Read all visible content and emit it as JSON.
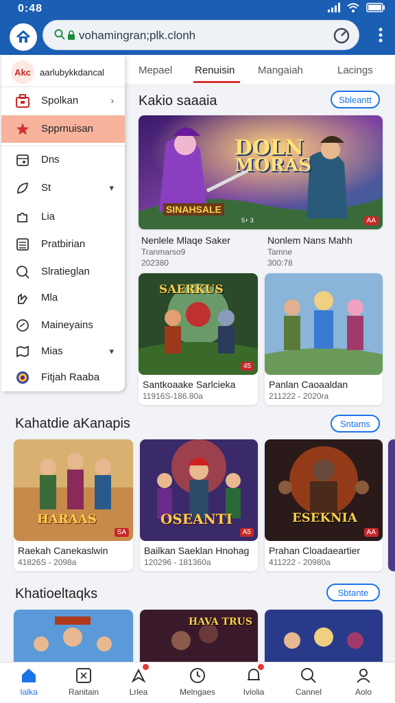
{
  "status": {
    "time": "0:48"
  },
  "browser": {
    "url": "vohamingran;plk.clonh"
  },
  "tabs": [
    {
      "label": "Mepael"
    },
    {
      "label": "Renuisin"
    },
    {
      "label": "Mangaiah"
    },
    {
      "label": "Lacings"
    }
  ],
  "drawer": {
    "logo": "Akc",
    "title": "aarlubykkdancal",
    "items": [
      {
        "label": "Spolkan",
        "chevron": "›"
      },
      {
        "label": "Spprnuisan",
        "chevron": ""
      },
      {
        "label": "Dns",
        "chevron": ""
      },
      {
        "label": "St",
        "chevron": "▾"
      },
      {
        "label": "Lia",
        "chevron": ""
      },
      {
        "label": "Pratbirian",
        "chevron": ""
      },
      {
        "label": "Slratieglan",
        "chevron": ""
      },
      {
        "label": "Mla",
        "chevron": ""
      },
      {
        "label": "Maineyains",
        "chevron": ""
      },
      {
        "label": "Mias",
        "chevron": "▾"
      },
      {
        "label": "Fitjah Raaba",
        "chevron": ""
      }
    ]
  },
  "section1": {
    "title": "Kakio saaaia",
    "pill": "Sbleantt",
    "hero": {
      "logo1": "DOLN",
      "logo2": "MORAS",
      "banner": "SINAHSALE",
      "badge": "AA",
      "badge2": "5+ 3"
    },
    "hero_left": {
      "name": "Nenlele Mlaqe Saker",
      "sub1": "Tranmarso9",
      "sub2": "202380"
    },
    "hero_right": {
      "name": "Nonlem Nans Mahh",
      "sub1": "Tamne",
      "sub2": "300:78"
    },
    "cards": [
      {
        "name": "Santkoaake Sarlcieka",
        "sub": "11916S-186.80a",
        "logo": "SAERKUS",
        "badge": "45"
      },
      {
        "name": "Panlan Caoaaldan",
        "sub": "211222 - 2020ra",
        "logo": "",
        "badge": ""
      }
    ]
  },
  "section2": {
    "title": "Kahatdie aKanapis",
    "pill": "Sntams",
    "cards": [
      {
        "name": "Raekah Canekaslwin",
        "sub": "41826S - 2098a",
        "logo": "HARAAS",
        "badge": "SA"
      },
      {
        "name": "Bailkan Saeklan Hnohag",
        "sub": "120296 - 181360a",
        "logo": "OSEANTI",
        "badge": "A5"
      },
      {
        "name": "Prahan Cloadaeartier",
        "sub": "411222 - 20980a",
        "logo": "ESEKNIA",
        "badge": "AA"
      }
    ]
  },
  "section3": {
    "title": "Khatioeltaqks",
    "pill": "Sbtante",
    "cards": [
      {
        "logo": ""
      },
      {
        "logo": "HAVA TRUS"
      },
      {
        "logo": ""
      }
    ]
  },
  "bottomnav": [
    {
      "label": "Ialka",
      "icon": "home-icon"
    },
    {
      "label": "Ranitain",
      "icon": "grid-icon"
    },
    {
      "label": "Lrlea",
      "icon": "compass-icon"
    },
    {
      "label": "Melngaes",
      "icon": "clock-icon"
    },
    {
      "label": "Iviolia",
      "icon": "bell-icon"
    },
    {
      "label": "Cannel",
      "icon": "search-icon"
    },
    {
      "label": "Aolo",
      "icon": "person-icon"
    }
  ],
  "colors": {
    "accent": "#1a5fb4",
    "active_tab": "#d3322f",
    "drawer_active": "#f7b39c",
    "link": "#1a73e8"
  }
}
